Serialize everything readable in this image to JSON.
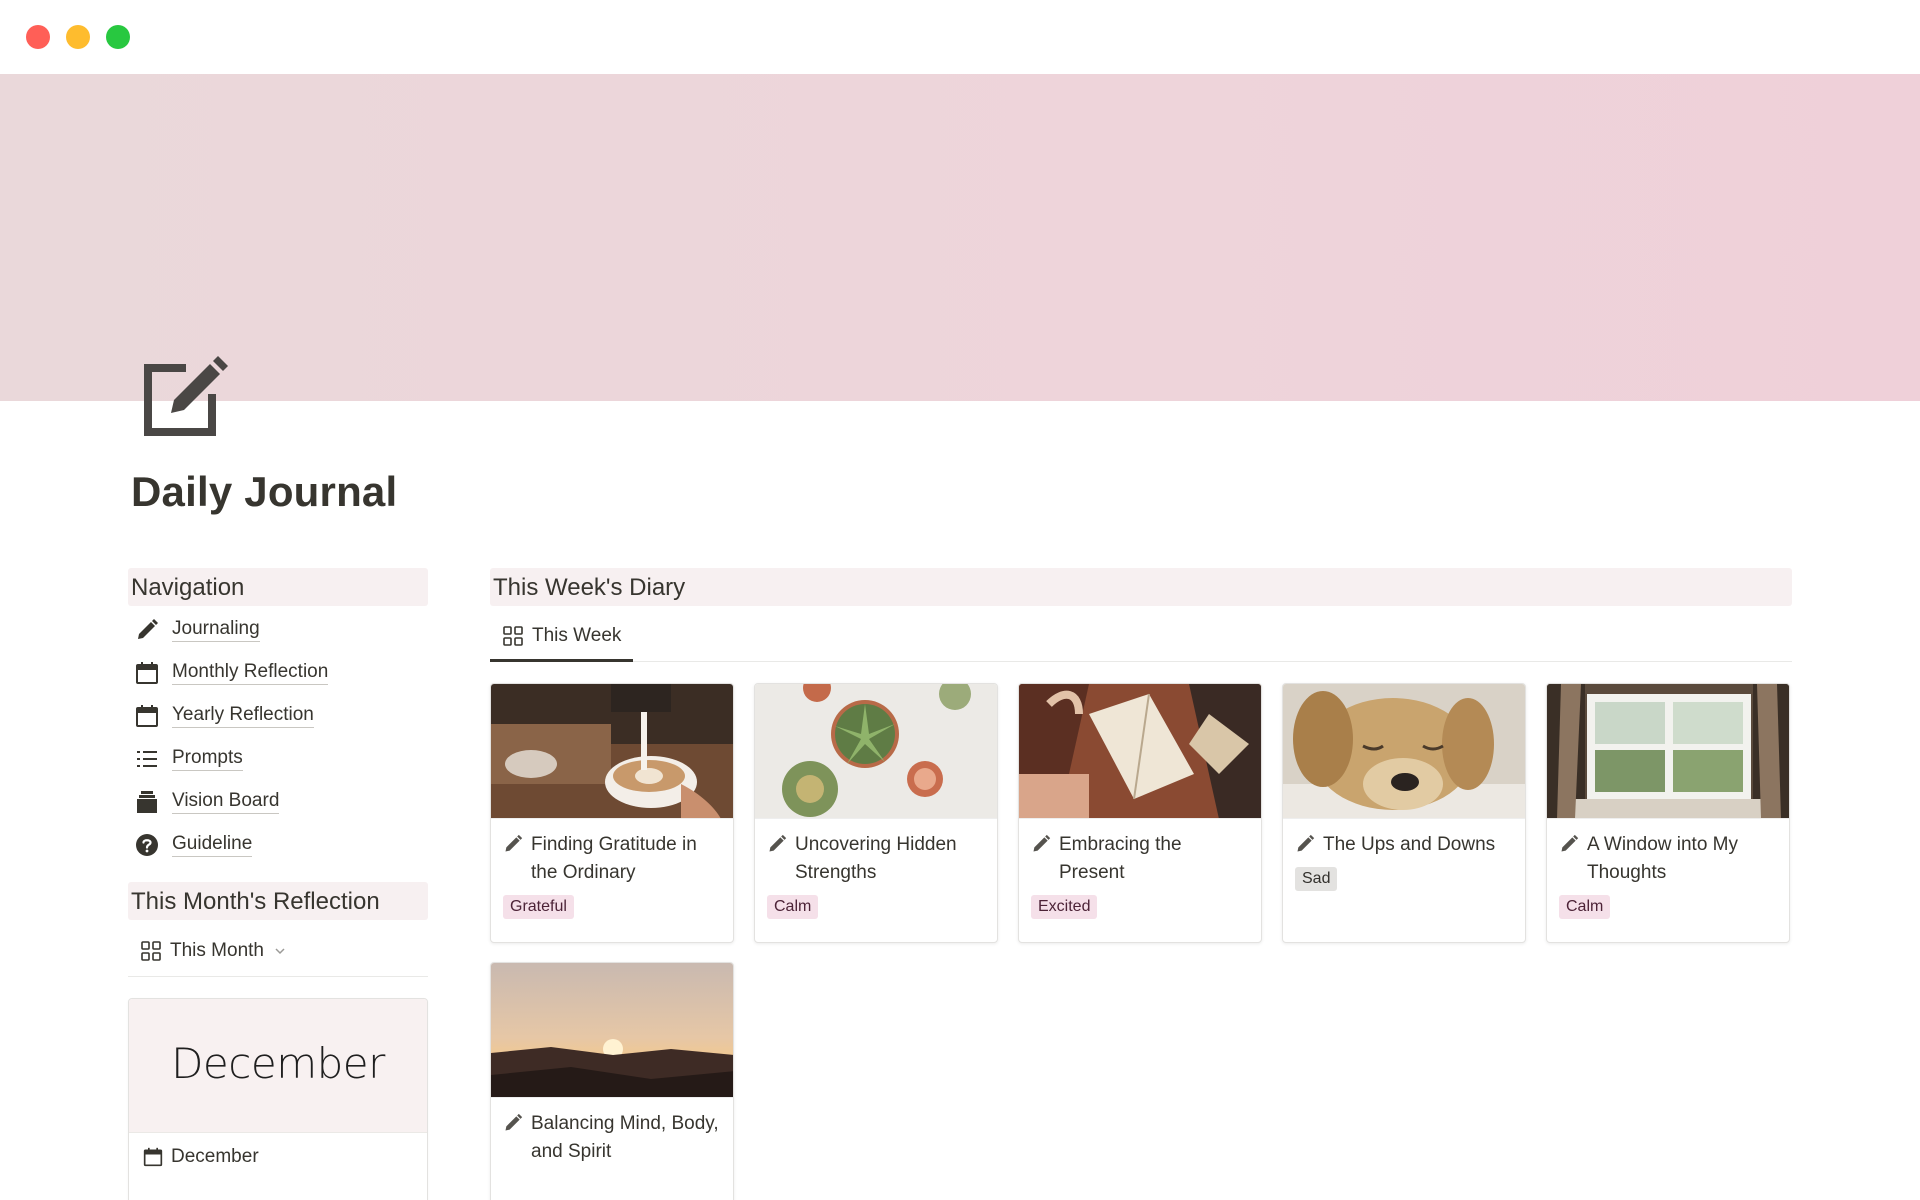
{
  "window": {
    "controls": [
      "close",
      "minimize",
      "maximize"
    ]
  },
  "page": {
    "icon": "edit-square-icon",
    "title": "Daily Journal"
  },
  "navigation": {
    "heading": "Navigation",
    "items": [
      {
        "label": "Journaling",
        "icon": "pencil-icon"
      },
      {
        "label": "Monthly Reflection",
        "icon": "calendar-icon"
      },
      {
        "label": "Yearly Reflection",
        "icon": "calendar-icon"
      },
      {
        "label": "Prompts",
        "icon": "list-icon"
      },
      {
        "label": "Vision Board",
        "icon": "stack-icon"
      },
      {
        "label": "Guideline",
        "icon": "help-circle-icon"
      }
    ]
  },
  "month_section": {
    "heading": "This Month's Reflection",
    "view_label": "This Month",
    "card": {
      "cover_text": "December",
      "title": "December"
    }
  },
  "diary_section": {
    "heading": "This Week's Diary",
    "view_label": "This Week",
    "entries": [
      {
        "title": "Finding Gratitude in the Ordinary",
        "tag": "Grateful",
        "image": "latte-art-photo"
      },
      {
        "title": "Uncovering Hidden Strengths",
        "tag": "Calm",
        "image": "succulents-photo"
      },
      {
        "title": "Embracing the Present",
        "tag": "Excited",
        "image": "reading-book-photo"
      },
      {
        "title": "The Ups and Downs",
        "tag": "Sad",
        "image": "sleeping-dog-photo"
      },
      {
        "title": "A Window into My Thoughts",
        "tag": "Calm",
        "image": "window-view-photo"
      },
      {
        "title": "Balancing Mind, Body, and Spirit",
        "tag": "",
        "image": "sunset-photo"
      }
    ]
  },
  "colors": {
    "cover": "#ecd4d9",
    "text": "#37352f",
    "section_bg": "#f7f0f1",
    "tag_pink": "#f5e0e9",
    "tag_gray": "#e3e2e0"
  }
}
